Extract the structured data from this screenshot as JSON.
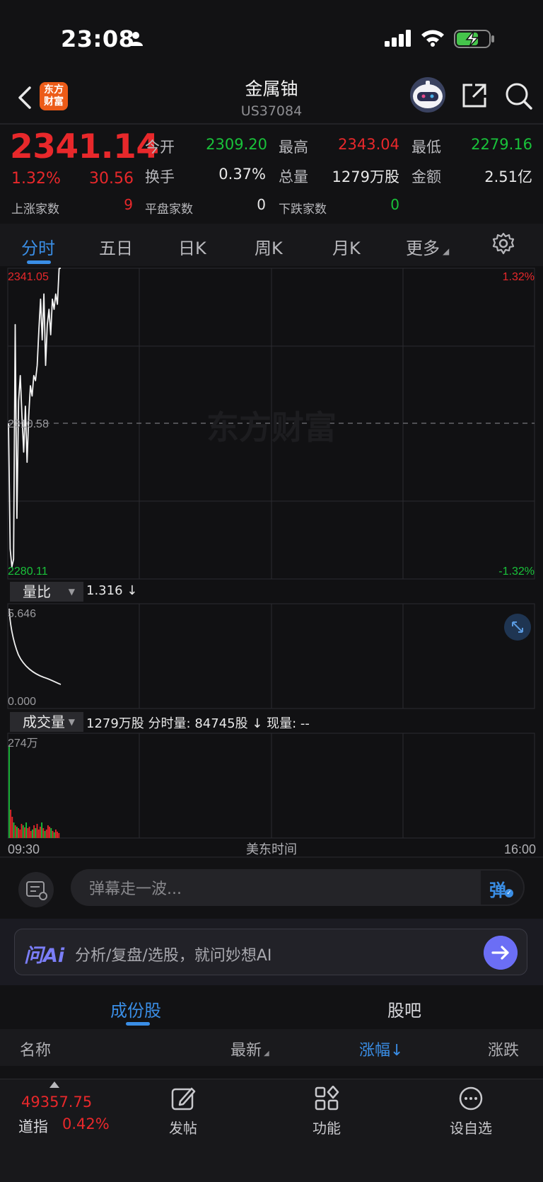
{
  "status_bar": {
    "time": "23:08"
  },
  "header": {
    "title": "金属铀",
    "code": "US37084",
    "logo_text": "东方\n财富"
  },
  "quote": {
    "price": "2341.14",
    "change_pct": "1.32%",
    "change": "30.56",
    "open_label": "今开",
    "open": "2309.20",
    "high_label": "最高",
    "high": "2343.04",
    "low_label": "最低",
    "low": "2279.16",
    "turnover_label": "换手",
    "turnover": "0.37%",
    "volume_label": "总量",
    "volume": "1279万股",
    "amount_label": "金额",
    "amount": "2.51亿",
    "up_label": "上涨家数",
    "up": "9",
    "flat_label": "平盘家数",
    "flat": "0",
    "down_label": "下跌家数",
    "down": "0"
  },
  "tabs": [
    "分时",
    "五日",
    "日K",
    "周K",
    "月K",
    "更多"
  ],
  "chart": {
    "top_price": "2341.05",
    "top_pct": "1.32%",
    "mid_price": "2310.58",
    "bottom_price": "2280.11",
    "bottom_pct": "-1.32%",
    "watermark": "东方财富",
    "ratio_selector": "量比",
    "ratio_value": "1.316 ↓",
    "ratio_max": "5.646",
    "ratio_min": "0.000",
    "vol_selector": "成交量",
    "vol_info": "1279万股 分时量: 84745股 ↓ 现量: --",
    "vol_max": "274万",
    "time_start": "09:30",
    "time_mid": "美东时间",
    "time_end": "16:00"
  },
  "chart_data": {
    "type": "line",
    "title": "",
    "xlabel": "美东时间",
    "ylabel": "",
    "ylim": [
      2280.11,
      2341.05
    ],
    "x_ticks": [
      "09:30",
      "16:00"
    ],
    "series": [
      {
        "values": [
          2310.6,
          2286.0,
          2282.5,
          2284.0,
          2330.0,
          2292.0,
          2315.0,
          2320.0,
          2312.0,
          2305.0,
          2314.0,
          2303.0,
          2312.0,
          2318.0,
          2316.0,
          2320.0,
          2319.0,
          2322.0,
          2329.0,
          2335.0,
          2327.0,
          2336.0,
          2322.0,
          2330.0,
          2333.0,
          2328.0,
          2335.0,
          2333.0,
          2336.0,
          2334.0,
          2341.0,
          2341.05
        ]
      }
    ]
  },
  "danmu": {
    "placeholder": "弹幕走一波...",
    "btn": "弹"
  },
  "ai": {
    "logo": "问Ai",
    "text": "分析/复盘/选股，就问妙想AI"
  },
  "sub_tabs": [
    "成份股",
    "股吧"
  ],
  "columns": [
    "名称",
    "最新",
    "涨幅↓",
    "涨跌"
  ],
  "bottom_nav": {
    "index_value": "49357.75",
    "index_name": "道指",
    "index_pct": "0.42%",
    "post": "发帖",
    "func": "功能",
    "fav": "设自选"
  }
}
